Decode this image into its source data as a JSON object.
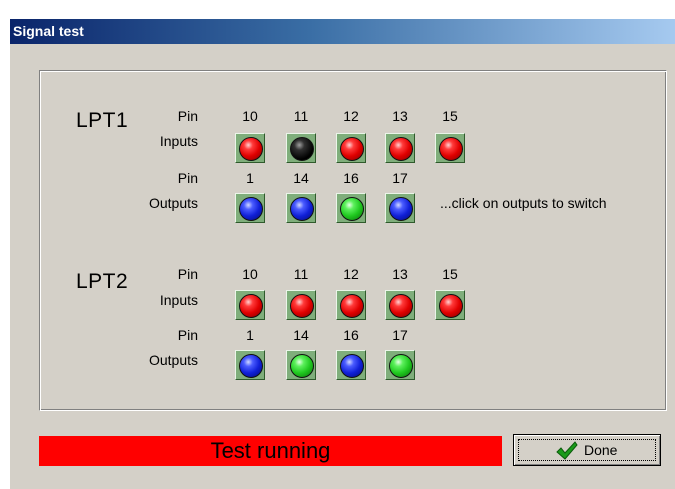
{
  "window": {
    "title": "Signal test"
  },
  "hint": "...click on outputs to switch",
  "labels": {
    "pin": "Pin",
    "inputs": "Inputs",
    "outputs": "Outputs"
  },
  "ports": [
    {
      "name": "LPT1",
      "inputs": [
        {
          "pin": "10",
          "state": "red"
        },
        {
          "pin": "11",
          "state": "black"
        },
        {
          "pin": "12",
          "state": "red"
        },
        {
          "pin": "13",
          "state": "red"
        },
        {
          "pin": "15",
          "state": "red"
        }
      ],
      "outputs": [
        {
          "pin": "1",
          "state": "blue"
        },
        {
          "pin": "14",
          "state": "blue"
        },
        {
          "pin": "16",
          "state": "green"
        },
        {
          "pin": "17",
          "state": "blue"
        }
      ]
    },
    {
      "name": "LPT2",
      "inputs": [
        {
          "pin": "10",
          "state": "red"
        },
        {
          "pin": "11",
          "state": "red"
        },
        {
          "pin": "12",
          "state": "red"
        },
        {
          "pin": "13",
          "state": "red"
        },
        {
          "pin": "15",
          "state": "red"
        }
      ],
      "outputs": [
        {
          "pin": "1",
          "state": "blue"
        },
        {
          "pin": "14",
          "state": "green"
        },
        {
          "pin": "16",
          "state": "blue"
        },
        {
          "pin": "17",
          "state": "green"
        }
      ]
    }
  ],
  "status": {
    "text": "Test running",
    "color": "#ff0000"
  },
  "done_button": {
    "label": "Done"
  },
  "colors": {
    "input_on": "#e00000",
    "input_off": "#000000",
    "output_a": "#1020d8",
    "output_b": "#1fc81f",
    "title_bar": "#0a246a"
  }
}
